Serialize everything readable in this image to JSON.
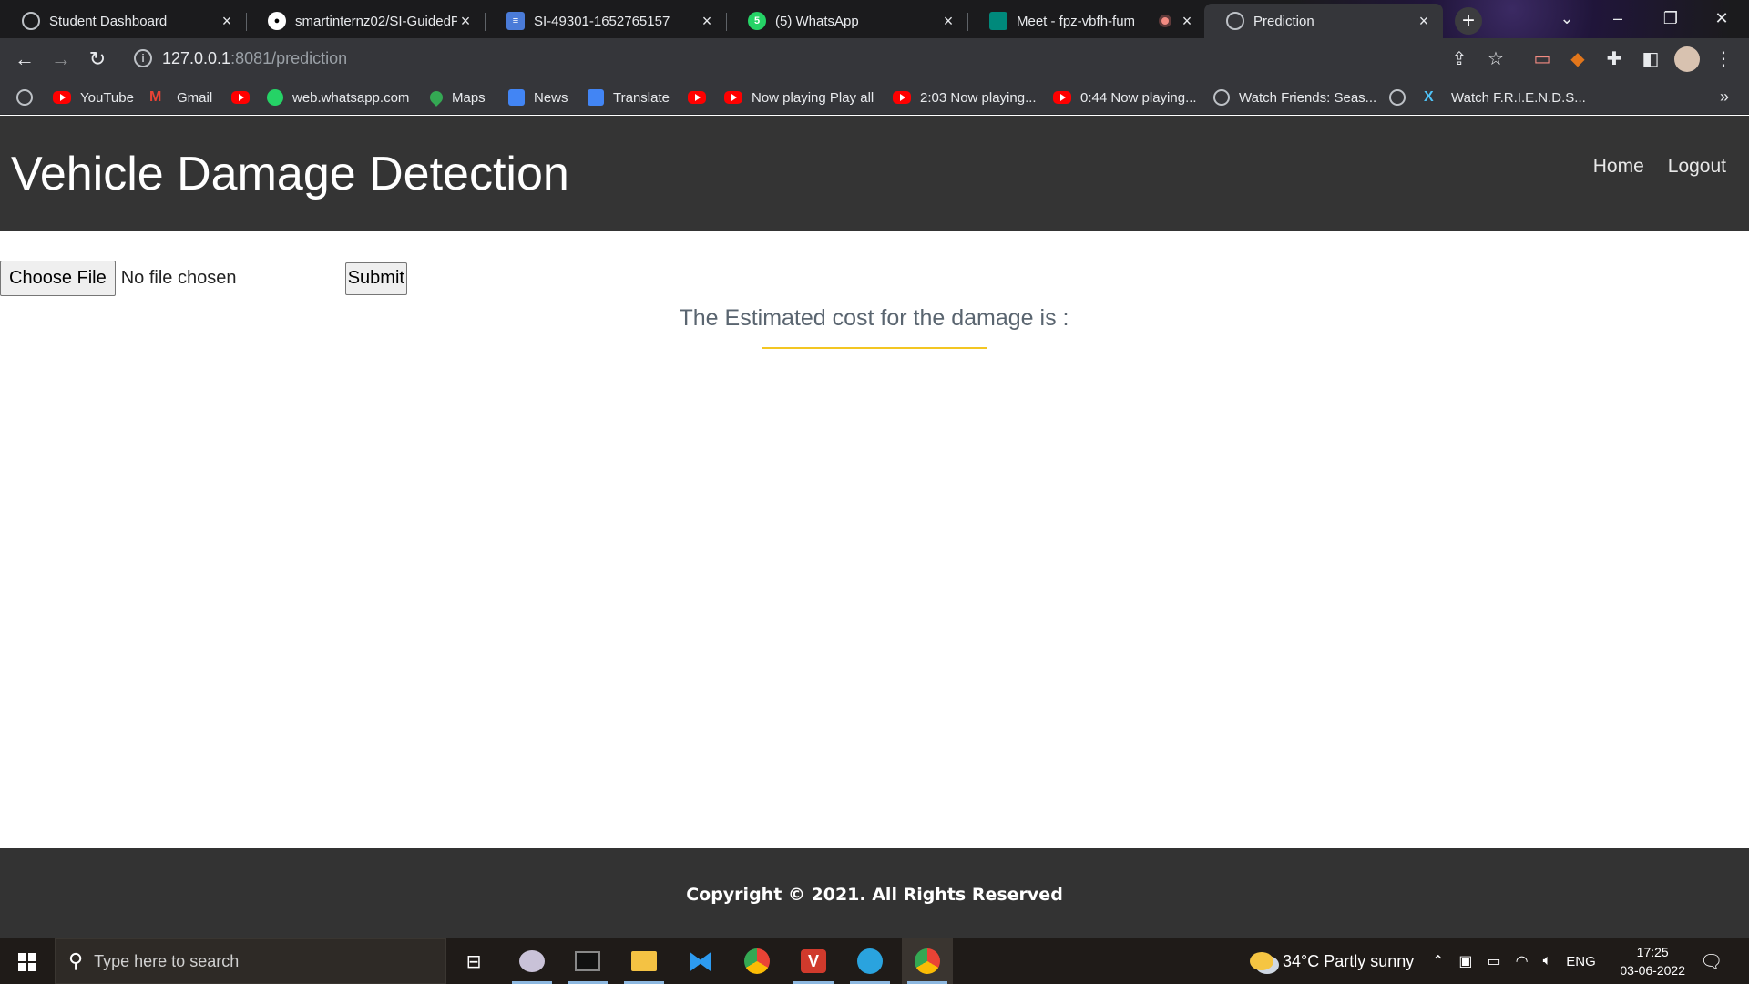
{
  "browser": {
    "tabs": [
      {
        "title": "Student Dashboard"
      },
      {
        "title": "smartinternz02/SI-GuidedP"
      },
      {
        "title": "SI-49301-1652765157"
      },
      {
        "title": "(5) WhatsApp"
      },
      {
        "title": "Meet - fpz-vbfh-fum"
      },
      {
        "title": "Prediction"
      }
    ],
    "url_host": "127.0.0.1",
    "url_rest": ":8081/prediction",
    "bookmarks": [
      {
        "label": "YouTube"
      },
      {
        "label": "Gmail"
      },
      {
        "label": "web.whatsapp.com"
      },
      {
        "label": "Maps"
      },
      {
        "label": "News"
      },
      {
        "label": "Translate"
      },
      {
        "label": "Now playing Play all"
      },
      {
        "label": "2:03 Now playing..."
      },
      {
        "label": "0:44 Now playing..."
      },
      {
        "label": "Watch Friends: Seas..."
      },
      {
        "label": "Watch F.R.I.E.N.D.S..."
      }
    ],
    "more_label": "»"
  },
  "page": {
    "site_title": "Vehicle Damage Detection",
    "nav": {
      "home": "Home",
      "logout": "Logout"
    },
    "choose_file_label": "Choose File",
    "no_file_text": "No file chosen",
    "submit_label": "Submit",
    "result_text": "The Estimated cost for the damage is :",
    "footer_text": "Copyright © 2021. All Rights Reserved",
    "accent_color": "#f3c623",
    "navbar_color": "#343434"
  },
  "taskbar": {
    "search_placeholder": "Type here to search",
    "weather": "34°C  Partly sunny",
    "language": "ENG",
    "time": "17:25",
    "date": "03-06-2022"
  }
}
